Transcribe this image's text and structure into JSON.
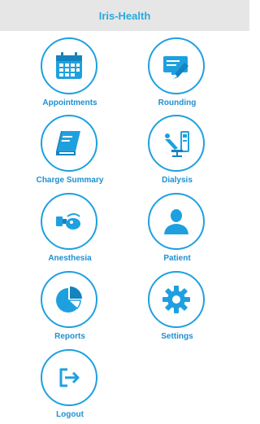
{
  "header": {
    "title": "Iris-Health"
  },
  "tiles": [
    {
      "label": "Appointments",
      "icon": "calendar-icon"
    },
    {
      "label": "Rounding",
      "icon": "clipboard-pen-icon"
    },
    {
      "label": "Charge Summary",
      "icon": "book-icon"
    },
    {
      "label": "Dialysis",
      "icon": "dialysis-chair-icon"
    },
    {
      "label": "Anesthesia",
      "icon": "anesthesia-mask-icon"
    },
    {
      "label": "Patient",
      "icon": "person-icon"
    },
    {
      "label": "Reports",
      "icon": "pie-chart-icon"
    },
    {
      "label": "Settings",
      "icon": "gear-icon"
    },
    {
      "label": "Logout",
      "icon": "logout-icon"
    }
  ],
  "colors": {
    "accent": "#1ea0e0",
    "header_bg": "#e6e6e6",
    "title": "#29a9e0"
  }
}
